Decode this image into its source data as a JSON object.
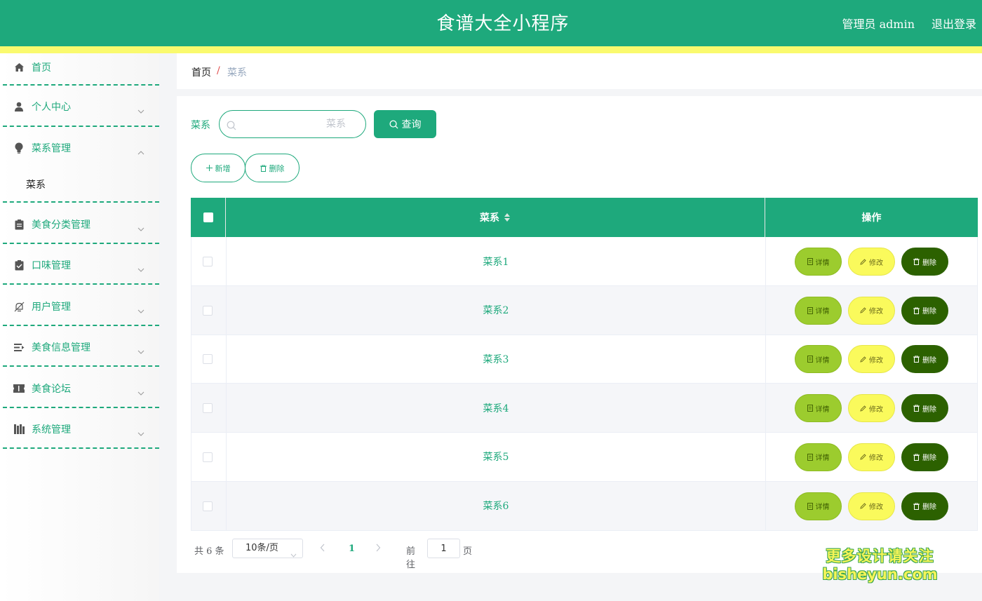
{
  "header": {
    "title": "食谱大全小程序",
    "user": "管理员 admin",
    "logout": "退出登录"
  },
  "sidebar": {
    "items": [
      {
        "label": "首页",
        "icon": "home-icon"
      },
      {
        "label": "个人中心",
        "icon": "user-icon"
      },
      {
        "label": "菜系管理",
        "icon": "lightbulb-icon",
        "expanded": true,
        "children": [
          {
            "label": "菜系"
          }
        ]
      },
      {
        "label": "美食分类管理",
        "icon": "clipboard-icon"
      },
      {
        "label": "口味管理",
        "icon": "checklist-icon"
      },
      {
        "label": "用户管理",
        "icon": "bell-off-icon"
      },
      {
        "label": "美食信息管理",
        "icon": "list-icon"
      },
      {
        "label": "美食论坛",
        "icon": "ticket-icon"
      },
      {
        "label": "系统管理",
        "icon": "books-icon"
      }
    ]
  },
  "breadcrumb": {
    "home": "首页",
    "separator": "/",
    "current": "菜系"
  },
  "search": {
    "label": "菜系",
    "placeholder": "菜系",
    "value": "",
    "button": "查询"
  },
  "actions": {
    "add": "新增",
    "delete": "删除"
  },
  "table": {
    "columns": [
      "菜系",
      "操作"
    ],
    "rows": [
      {
        "name": "菜系1"
      },
      {
        "name": "菜系2"
      },
      {
        "name": "菜系3"
      },
      {
        "name": "菜系4"
      },
      {
        "name": "菜系5"
      },
      {
        "name": "菜系6"
      }
    ],
    "row_actions": {
      "detail": "详情",
      "edit": "修改",
      "delete": "删除"
    }
  },
  "pagination": {
    "total": "共 6 条",
    "page_size": "10条/页",
    "current_page": "1",
    "goto_label": "前往",
    "goto_value": "1",
    "page_suffix": "页"
  },
  "watermark": {
    "line1": "更多设计请关注",
    "line2": "bisheyun.com"
  },
  "colors": {
    "primary": "#1ea97c",
    "strip": "#fafa6e",
    "detail": "#9ccc2e",
    "edit": "#fafa5c",
    "delete": "#2c6100"
  }
}
